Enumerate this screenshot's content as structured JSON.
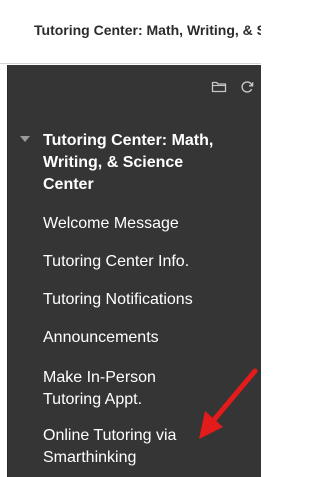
{
  "header": {
    "title": "Tutoring Center: Math, Writing, & Science Center"
  },
  "toolbar": {
    "icons": [
      "folder-icon",
      "refresh-icon"
    ]
  },
  "course": {
    "title": "Tutoring Center: Math, Writing, & Science Center",
    "expanded": true
  },
  "menu": {
    "items": [
      {
        "label": "Welcome Message"
      },
      {
        "label": "Tutoring Center Info."
      },
      {
        "label": "Tutoring Notifications"
      },
      {
        "label": "Announcements"
      },
      {
        "label": "Make In-Person Tutoring Appt."
      },
      {
        "label": "Online Tutoring via Smarthinking"
      }
    ]
  },
  "colors": {
    "sidebar_bg": "#353535",
    "annotation_arrow": "#e31b1b",
    "text_light": "#ffffff"
  }
}
